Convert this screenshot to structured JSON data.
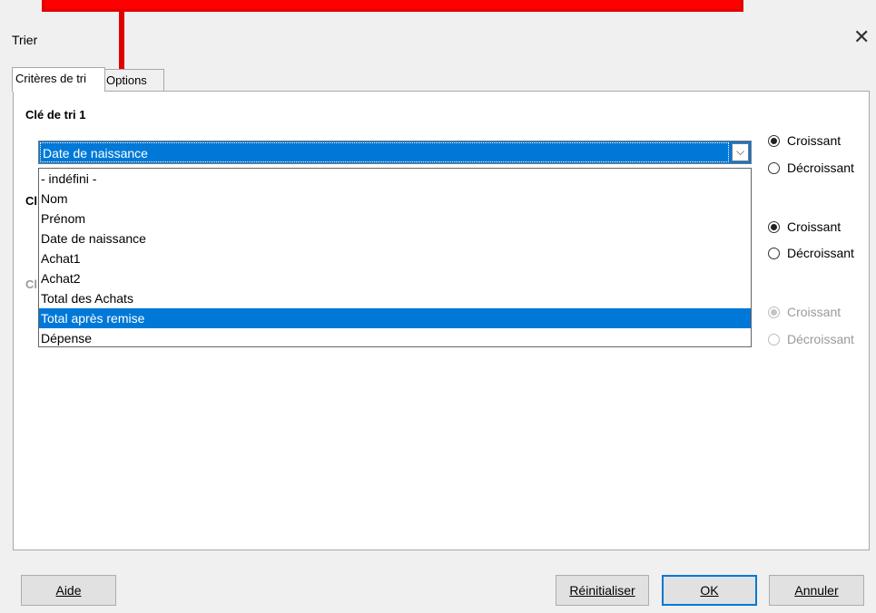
{
  "dialog": {
    "title": "Trier",
    "close_glyph": "✕"
  },
  "tabs": [
    {
      "label": "Critères de tri"
    },
    {
      "label": "Options"
    }
  ],
  "key1": {
    "label": "Clé de tri 1",
    "selected": "Date de naissance",
    "options": [
      "- indéfini -",
      "Nom",
      "Prénom",
      "Date de naissance",
      "Achat1",
      "Achat2",
      "Total des Achats",
      "Total après remise",
      "Dépense"
    ],
    "highlighted": "Total après remise",
    "asc_label": "Croissant",
    "desc_label": "Décroissant"
  },
  "key2": {
    "label_visible": "Cl",
    "asc_label": "Croissant",
    "desc_label": "Décroissant"
  },
  "key3": {
    "label_visible": "Cl",
    "asc_label": "Croissant",
    "desc_label": "Décroissant"
  },
  "buttons": {
    "help": "Aide",
    "reset": "Réinitialiser",
    "ok": "OK",
    "cancel": "Annuler"
  },
  "colors": {
    "annotation": "#ff0000",
    "selection": "#0078d7"
  }
}
